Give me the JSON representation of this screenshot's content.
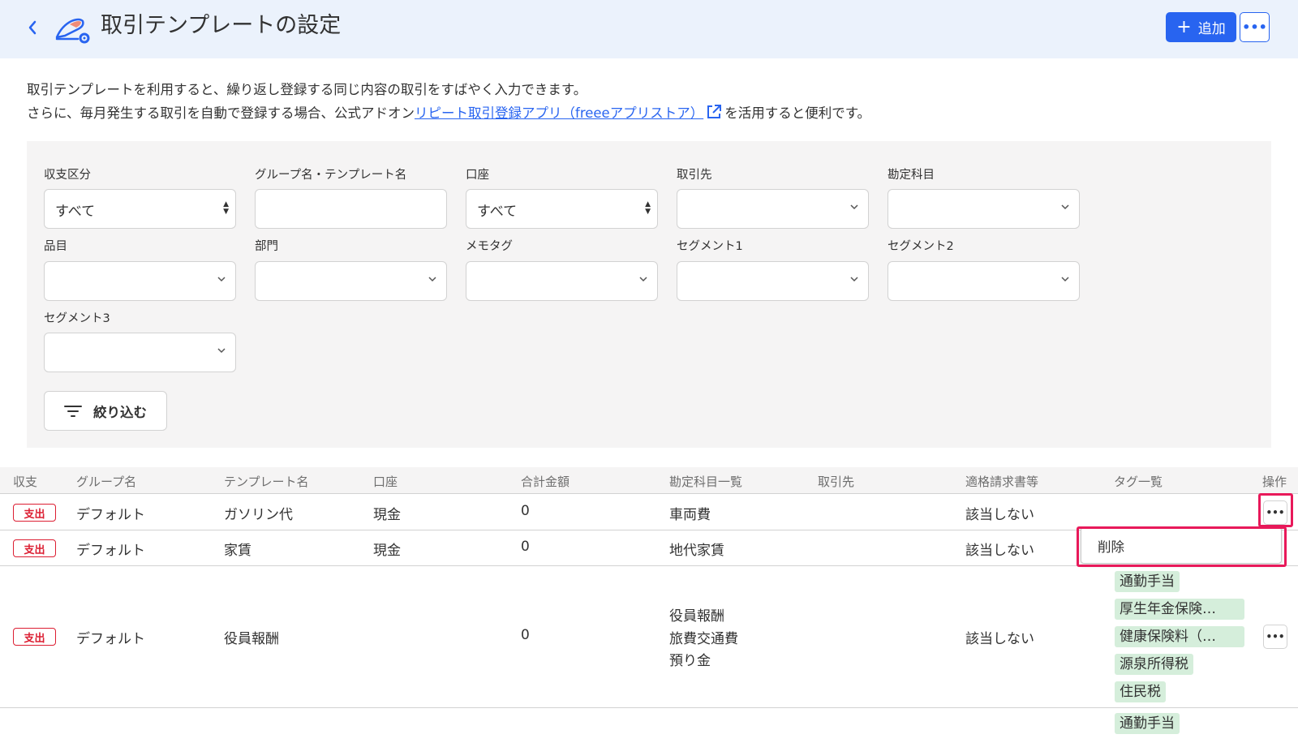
{
  "header": {
    "title": "取引テンプレートの設定",
    "add_label": "追加",
    "add_icon": "plus-icon",
    "more_icon": "ellipsis-icon"
  },
  "description": {
    "line1": "取引テンプレートを利用すると、繰り返し登録する同じ内容の取引をすばやく入力できます。",
    "line2_prefix": "さらに、毎月発生する取引を自動で登録する場合、公式アドオン",
    "line2_link": "リピート取引登録アプリ（freeeアプリストア）",
    "line2_suffix": "を活用すると便利です。"
  },
  "filters": {
    "type_label": "収支区分",
    "type_value": "すべて",
    "name_label": "グループ名・テンプレート名",
    "account_label": "口座",
    "account_value": "すべて",
    "partner_label": "取引先",
    "item_label": "勘定科目",
    "product_label": "品目",
    "section_label": "部門",
    "memo_label": "メモタグ",
    "segment1_label": "セグメント1",
    "segment2_label": "セグメント2",
    "segment3_label": "セグメント3",
    "apply_label": "絞り込む"
  },
  "table": {
    "headers": [
      "収支",
      "グループ名",
      "テンプレート名",
      "口座",
      "合計金額",
      "勘定科目一覧",
      "取引先",
      "適格請求書等",
      "タグ一覧",
      "操作"
    ],
    "rows": [
      {
        "type": "支出",
        "group": "デフォルト",
        "name": "ガソリン代",
        "account": "現金",
        "total": "0",
        "items": [
          "車両費"
        ],
        "invoice": "該当しない",
        "tags": []
      },
      {
        "type": "支出",
        "group": "デフォルト",
        "name": "家賃",
        "account": "現金",
        "total": "0",
        "items": [
          "地代家賃"
        ],
        "invoice": "該当しない",
        "tags": []
      },
      {
        "type": "支出",
        "group": "デフォルト",
        "name": "役員報酬",
        "account": "",
        "total": "0",
        "items": [
          "役員報酬",
          "旅費交通費",
          "預り金"
        ],
        "invoice": "該当しない",
        "tags": [
          "通勤手当",
          "厚生年金保険…",
          "健康保険料（…",
          "源泉所得税",
          "住民税"
        ]
      },
      {
        "tags": [
          "通勤手当"
        ]
      }
    ]
  },
  "dropdown_menu": {
    "delete_label": "削除"
  },
  "colors": {
    "accent": "#2864f0",
    "header_bg": "#ebf2fc",
    "expense_red": "#dc1e32",
    "highlight_pink": "#e8195a",
    "tag_bg": "#d5eedb"
  }
}
